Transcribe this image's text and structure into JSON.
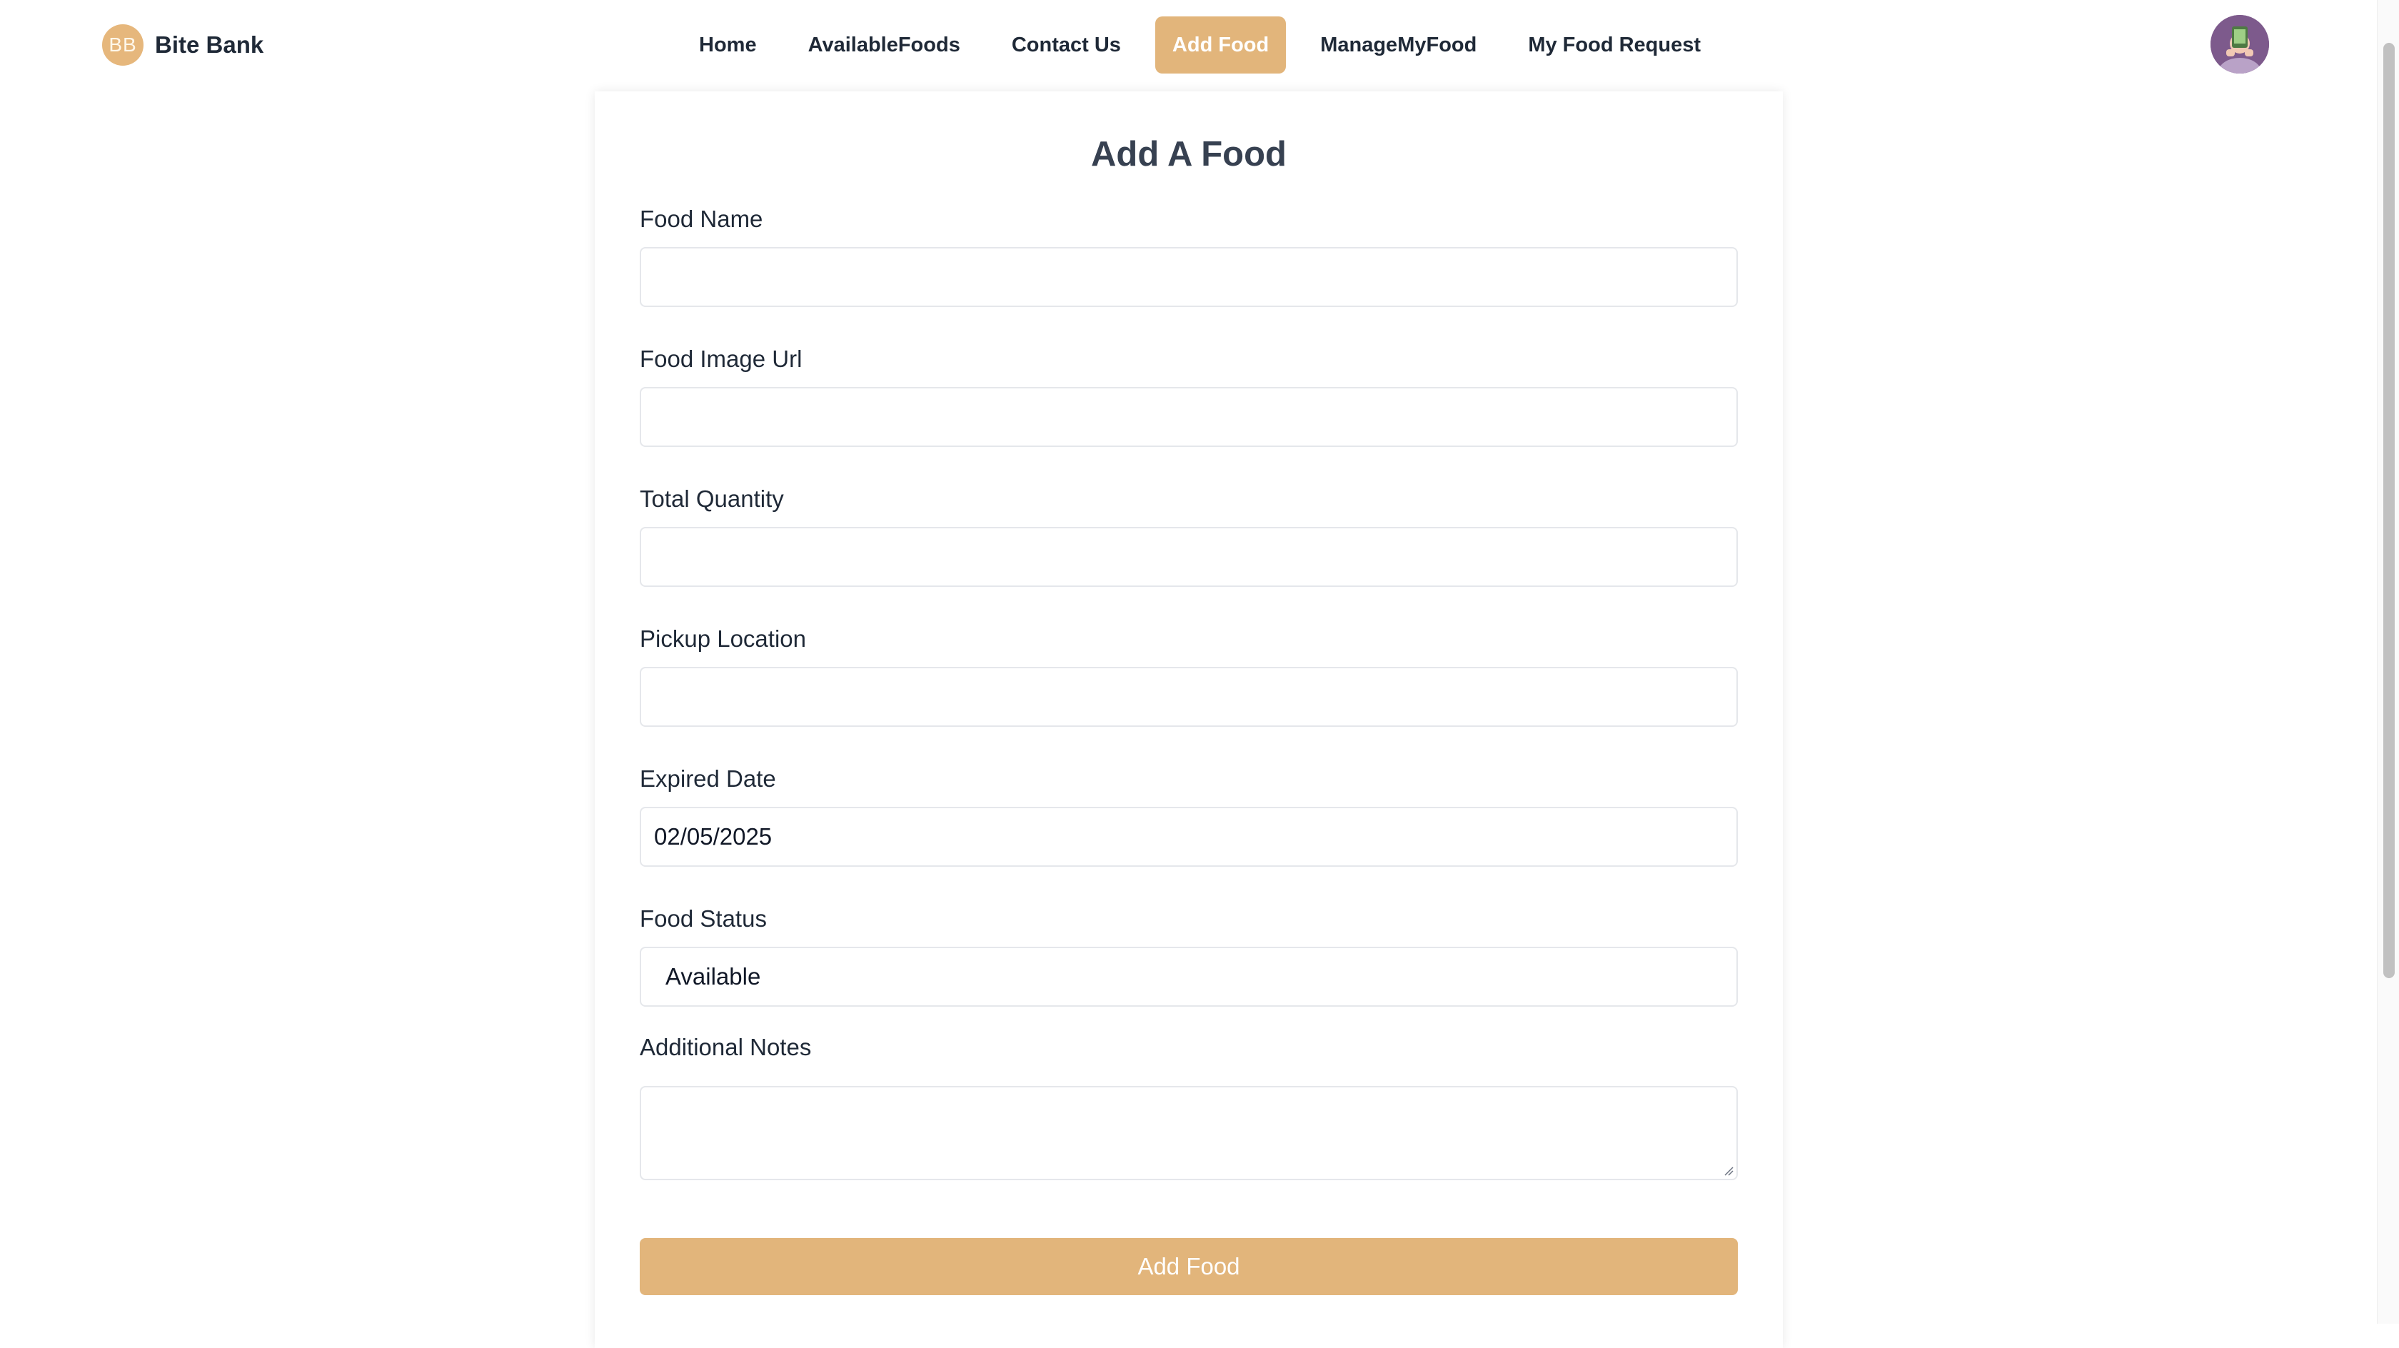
{
  "brand": {
    "logo_text": "BB",
    "name": "Bite Bank"
  },
  "nav": {
    "items": [
      {
        "label": "Home",
        "active": false
      },
      {
        "label": "AvailableFoods",
        "active": false
      },
      {
        "label": "Contact Us",
        "active": false
      },
      {
        "label": "Add Food",
        "active": true
      },
      {
        "label": "ManageMyFood",
        "active": false
      },
      {
        "label": "My Food Request",
        "active": false
      }
    ]
  },
  "form": {
    "title": "Add A Food",
    "fields": {
      "food_name": {
        "label": "Food Name",
        "value": ""
      },
      "food_image_url": {
        "label": "Food Image Url",
        "value": ""
      },
      "total_quantity": {
        "label": "Total Quantity",
        "value": ""
      },
      "pickup_location": {
        "label": "Pickup Location",
        "value": ""
      },
      "expired_date": {
        "label": "Expired Date",
        "value": "02/05/2025"
      },
      "food_status": {
        "label": "Food Status",
        "value": "Available"
      },
      "additional_notes": {
        "label": "Additional Notes",
        "value": ""
      }
    },
    "submit_label": "Add Food"
  },
  "colors": {
    "accent": "#e2b57b",
    "logo_bg": "#e6b77c",
    "avatar_bg": "#7d5a8c"
  },
  "icons": [
    "user-avatar-icon",
    "textarea-resize-icon"
  ]
}
